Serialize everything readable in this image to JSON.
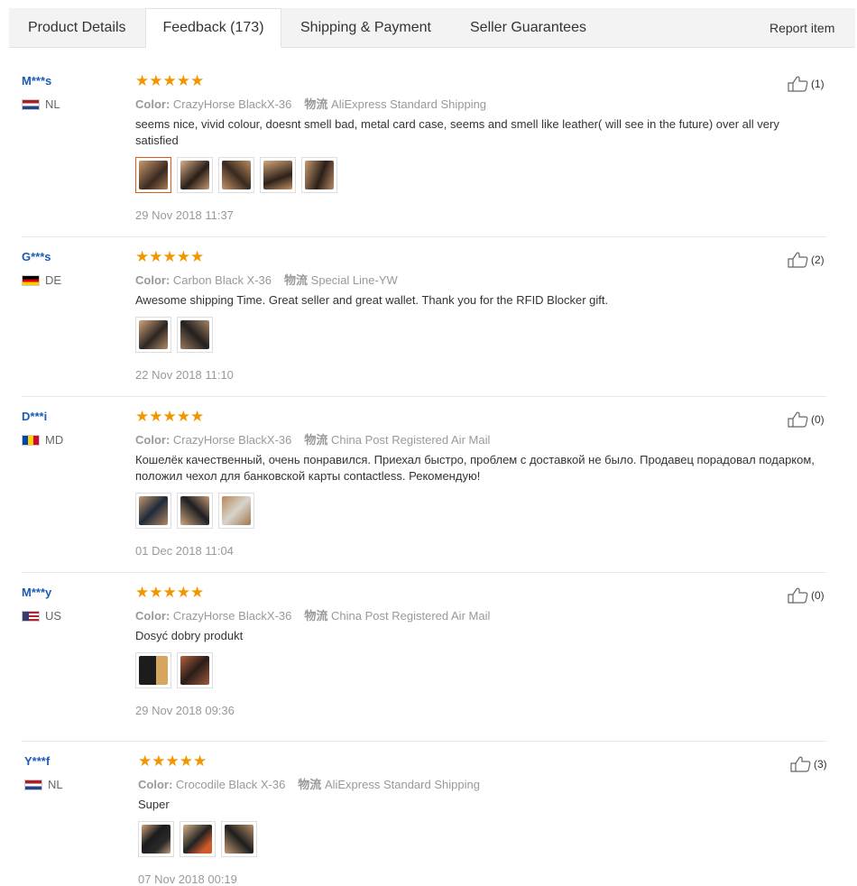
{
  "tabs": [
    {
      "label": "Product Details"
    },
    {
      "label": "Feedback (173)"
    },
    {
      "label": "Shipping & Payment"
    },
    {
      "label": "Seller Guarantees"
    }
  ],
  "report_label": "Report item",
  "meta_labels": {
    "color": "Color:",
    "shipping": "物流"
  },
  "rating_stars": "★★★★★",
  "reviews": [
    {
      "user": "M***s",
      "country": "NL",
      "color": "CrazyHorse BlackX-36",
      "shipping": "AliExpress Standard Shipping",
      "text": "seems nice, vivid colour, doesnt smell bad, metal card case, seems and smell like leather( will see in the future) over all very satisfied",
      "date": "29 Nov 2018 11:37",
      "likes": "(1)"
    },
    {
      "user": "G***s",
      "country": "DE",
      "color": "Carbon Black X-36",
      "shipping": "Special Line-YW",
      "text": "Awesome shipping Time. Great seller and great wallet. Thank you for the RFID Blocker gift.",
      "date": "22 Nov 2018 11:10",
      "likes": "(2)"
    },
    {
      "user": "D***i",
      "country": "MD",
      "color": "CrazyHorse BlackX-36",
      "shipping": "China Post Registered Air Mail",
      "text": "Кошелёк качественный, очень понравился. Приехал быстро, проблем с доставкой не было. Продавец порадовал подарком, положил чехол для банковской карты contactless. Рекомендую!",
      "date": "01 Dec 2018 11:04",
      "likes": "(0)"
    },
    {
      "user": "M***y",
      "country": "US",
      "color": "CrazyHorse BlackX-36",
      "shipping": "China Post Registered Air Mail",
      "text": "Dosyć dobry produkt",
      "date": "29 Nov 2018 09:36",
      "likes": "(0)"
    },
    {
      "user": "Y***f",
      "country": "NL",
      "color": "Crocodile Black X-36",
      "shipping": "AliExpress Standard Shipping",
      "text": "Super",
      "date": "07 Nov 2018 00:19",
      "likes": "(3)"
    }
  ]
}
